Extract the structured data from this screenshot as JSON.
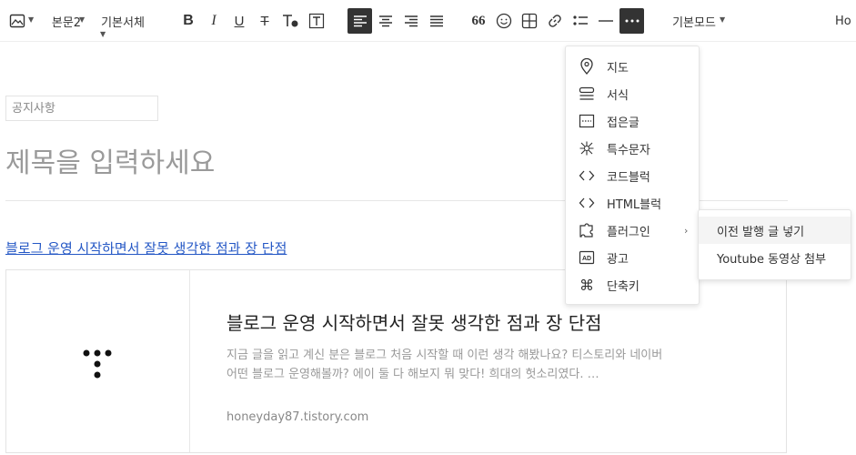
{
  "toolbar": {
    "paragraph_style": "본문2",
    "font_family": "기본서체",
    "mode": "기본모드",
    "right_text": "Ho",
    "quote_label": "66"
  },
  "editor": {
    "category_placeholder": "공지사항",
    "title_placeholder": "제목을 입력하세요",
    "link_text": "블로그 운영 시작하면서 잘못 생각한 점과 장 단점"
  },
  "card": {
    "title": "블로그 운영 시작하면서 잘못 생각한 점과 장 단점",
    "description": "지금 글을 읽고 계신 분은 블로그 처음 시작할 때 이런 생각 해봤나요? 티스토리와 네이버 어떤 블로그 운영해볼까? 에이 둘 다 해보지 뭐 맞다! 희대의 헛소리였다. …",
    "url": "honeyday87.tistory.com"
  },
  "more_menu": {
    "items": [
      {
        "label": "지도",
        "icon": "map-pin-icon"
      },
      {
        "label": "서식",
        "icon": "template-icon"
      },
      {
        "label": "접은글",
        "icon": "fold-icon"
      },
      {
        "label": "특수문자",
        "icon": "special-char-icon"
      },
      {
        "label": "코드블럭",
        "icon": "code-icon"
      },
      {
        "label": "HTML블럭",
        "icon": "html-icon"
      },
      {
        "label": "플러그인",
        "icon": "plugin-icon"
      },
      {
        "label": "광고",
        "icon": "ad-icon"
      },
      {
        "label": "단축키",
        "icon": "command-icon"
      }
    ]
  },
  "plugin_submenu": {
    "items": [
      {
        "label": "이전 발행 글 넣기"
      },
      {
        "label": "Youtube 동영상 첨부"
      }
    ]
  },
  "colors": {
    "link": "#2457c5",
    "active_button": "#333333",
    "placeholder": "#9a9a9a"
  }
}
